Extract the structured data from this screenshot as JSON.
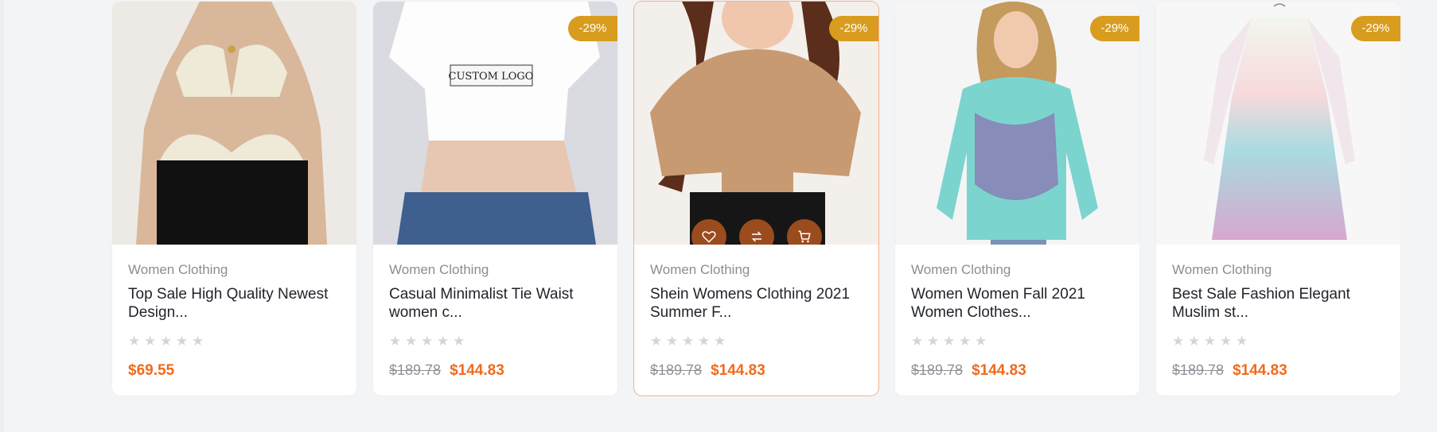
{
  "colors": {
    "badge": "#d89c1e",
    "price": "#f26a1b",
    "old_price": "#8e9196",
    "category": "#8a8d93",
    "title": "#1f2329",
    "star": "#d3d5d9",
    "active_border": "#f3b08a"
  },
  "products": [
    {
      "category": "Women Clothing",
      "title_line1": "Top Sale High Quality Newest",
      "title_line2": "Design...",
      "rating": 0,
      "old_price": "",
      "price": "$69.55",
      "badge": ""
    },
    {
      "category": "Women Clothing",
      "title_line1": "Casual Minimalist Tie Waist",
      "title_line2": "women c...",
      "rating": 0,
      "old_price": "$189.78",
      "price": "$144.83",
      "badge": "-29%",
      "image_text": "CUSTOM LOGO"
    },
    {
      "category": "Women Clothing",
      "title_line1": "Shein Womens Clothing 2021",
      "title_line2": "Summer F...",
      "rating": 0,
      "old_price": "$189.78",
      "price": "$144.83",
      "badge": "-29%",
      "actions": [
        "heart-icon",
        "compare-icon",
        "cart-icon"
      ]
    },
    {
      "category": "Women Clothing",
      "title_line1": "Women Women Fall 2021",
      "title_line2": "Women Clothes...",
      "rating": 0,
      "old_price": "$189.78",
      "price": "$144.83",
      "badge": "-29%"
    },
    {
      "category": "Women Clothing",
      "title_line1": "Best Sale Fashion Elegant",
      "title_line2": "Muslim st...",
      "rating": 0,
      "old_price": "$189.78",
      "price": "$144.83",
      "badge": "-29%"
    }
  ]
}
